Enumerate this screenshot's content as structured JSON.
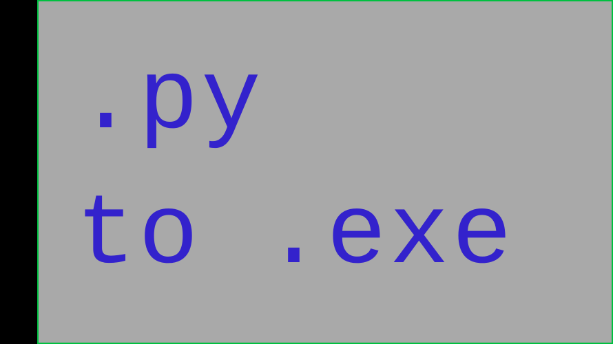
{
  "content": {
    "line1": ".py",
    "line2": "to .exe"
  }
}
